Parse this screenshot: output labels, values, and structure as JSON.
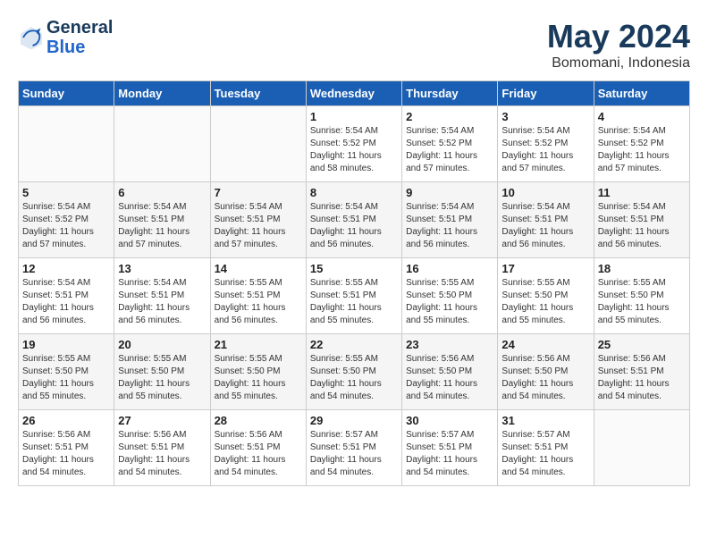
{
  "logo": {
    "line1": "General",
    "line2": "Blue"
  },
  "title": "May 2024",
  "subtitle": "Bomomani, Indonesia",
  "weekdays": [
    "Sunday",
    "Monday",
    "Tuesday",
    "Wednesday",
    "Thursday",
    "Friday",
    "Saturday"
  ],
  "weeks": [
    [
      {
        "day": "",
        "info": ""
      },
      {
        "day": "",
        "info": ""
      },
      {
        "day": "",
        "info": ""
      },
      {
        "day": "1",
        "info": "Sunrise: 5:54 AM\nSunset: 5:52 PM\nDaylight: 11 hours\nand 58 minutes."
      },
      {
        "day": "2",
        "info": "Sunrise: 5:54 AM\nSunset: 5:52 PM\nDaylight: 11 hours\nand 57 minutes."
      },
      {
        "day": "3",
        "info": "Sunrise: 5:54 AM\nSunset: 5:52 PM\nDaylight: 11 hours\nand 57 minutes."
      },
      {
        "day": "4",
        "info": "Sunrise: 5:54 AM\nSunset: 5:52 PM\nDaylight: 11 hours\nand 57 minutes."
      }
    ],
    [
      {
        "day": "5",
        "info": "Sunrise: 5:54 AM\nSunset: 5:52 PM\nDaylight: 11 hours\nand 57 minutes."
      },
      {
        "day": "6",
        "info": "Sunrise: 5:54 AM\nSunset: 5:51 PM\nDaylight: 11 hours\nand 57 minutes."
      },
      {
        "day": "7",
        "info": "Sunrise: 5:54 AM\nSunset: 5:51 PM\nDaylight: 11 hours\nand 57 minutes."
      },
      {
        "day": "8",
        "info": "Sunrise: 5:54 AM\nSunset: 5:51 PM\nDaylight: 11 hours\nand 56 minutes."
      },
      {
        "day": "9",
        "info": "Sunrise: 5:54 AM\nSunset: 5:51 PM\nDaylight: 11 hours\nand 56 minutes."
      },
      {
        "day": "10",
        "info": "Sunrise: 5:54 AM\nSunset: 5:51 PM\nDaylight: 11 hours\nand 56 minutes."
      },
      {
        "day": "11",
        "info": "Sunrise: 5:54 AM\nSunset: 5:51 PM\nDaylight: 11 hours\nand 56 minutes."
      }
    ],
    [
      {
        "day": "12",
        "info": "Sunrise: 5:54 AM\nSunset: 5:51 PM\nDaylight: 11 hours\nand 56 minutes."
      },
      {
        "day": "13",
        "info": "Sunrise: 5:54 AM\nSunset: 5:51 PM\nDaylight: 11 hours\nand 56 minutes."
      },
      {
        "day": "14",
        "info": "Sunrise: 5:55 AM\nSunset: 5:51 PM\nDaylight: 11 hours\nand 56 minutes."
      },
      {
        "day": "15",
        "info": "Sunrise: 5:55 AM\nSunset: 5:51 PM\nDaylight: 11 hours\nand 55 minutes."
      },
      {
        "day": "16",
        "info": "Sunrise: 5:55 AM\nSunset: 5:50 PM\nDaylight: 11 hours\nand 55 minutes."
      },
      {
        "day": "17",
        "info": "Sunrise: 5:55 AM\nSunset: 5:50 PM\nDaylight: 11 hours\nand 55 minutes."
      },
      {
        "day": "18",
        "info": "Sunrise: 5:55 AM\nSunset: 5:50 PM\nDaylight: 11 hours\nand 55 minutes."
      }
    ],
    [
      {
        "day": "19",
        "info": "Sunrise: 5:55 AM\nSunset: 5:50 PM\nDaylight: 11 hours\nand 55 minutes."
      },
      {
        "day": "20",
        "info": "Sunrise: 5:55 AM\nSunset: 5:50 PM\nDaylight: 11 hours\nand 55 minutes."
      },
      {
        "day": "21",
        "info": "Sunrise: 5:55 AM\nSunset: 5:50 PM\nDaylight: 11 hours\nand 55 minutes."
      },
      {
        "day": "22",
        "info": "Sunrise: 5:55 AM\nSunset: 5:50 PM\nDaylight: 11 hours\nand 54 minutes."
      },
      {
        "day": "23",
        "info": "Sunrise: 5:56 AM\nSunset: 5:50 PM\nDaylight: 11 hours\nand 54 minutes."
      },
      {
        "day": "24",
        "info": "Sunrise: 5:56 AM\nSunset: 5:50 PM\nDaylight: 11 hours\nand 54 minutes."
      },
      {
        "day": "25",
        "info": "Sunrise: 5:56 AM\nSunset: 5:51 PM\nDaylight: 11 hours\nand 54 minutes."
      }
    ],
    [
      {
        "day": "26",
        "info": "Sunrise: 5:56 AM\nSunset: 5:51 PM\nDaylight: 11 hours\nand 54 minutes."
      },
      {
        "day": "27",
        "info": "Sunrise: 5:56 AM\nSunset: 5:51 PM\nDaylight: 11 hours\nand 54 minutes."
      },
      {
        "day": "28",
        "info": "Sunrise: 5:56 AM\nSunset: 5:51 PM\nDaylight: 11 hours\nand 54 minutes."
      },
      {
        "day": "29",
        "info": "Sunrise: 5:57 AM\nSunset: 5:51 PM\nDaylight: 11 hours\nand 54 minutes."
      },
      {
        "day": "30",
        "info": "Sunrise: 5:57 AM\nSunset: 5:51 PM\nDaylight: 11 hours\nand 54 minutes."
      },
      {
        "day": "31",
        "info": "Sunrise: 5:57 AM\nSunset: 5:51 PM\nDaylight: 11 hours\nand 54 minutes."
      },
      {
        "day": "",
        "info": ""
      }
    ]
  ]
}
